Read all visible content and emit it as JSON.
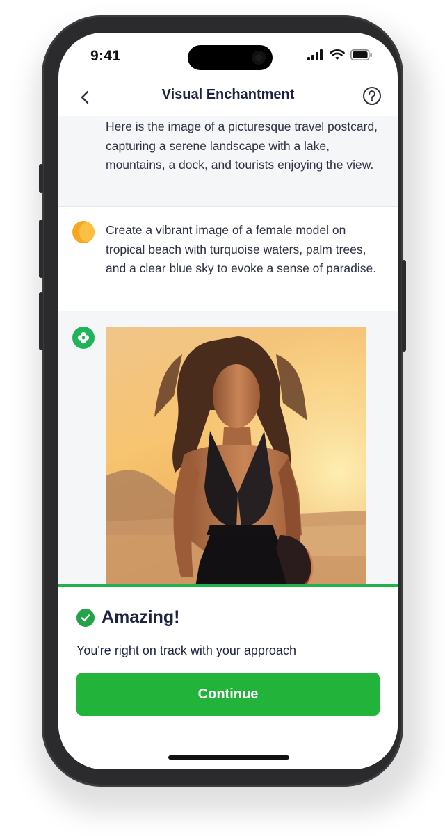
{
  "status_bar": {
    "time": "9:41"
  },
  "header": {
    "title": "Visual Enchantment",
    "back_icon": "chevron-left-icon",
    "help_icon": "question-circle-icon"
  },
  "conversation": {
    "messages": [
      {
        "role": "assistant",
        "text": "Here is the image of a picturesque travel postcard, capturing a serene landscape with a lake, mountains, a dock, and tourists enjoying the view."
      },
      {
        "role": "user",
        "avatar_color": "#f6a623",
        "text": "Create a vibrant image of a female model on tropical beach with turquoise waters, palm trees, and a clear blue sky to evoke a sense of paradise."
      },
      {
        "role": "assistant",
        "avatar_color": "#21b35a",
        "image": "generated-image"
      }
    ]
  },
  "feedback": {
    "icon": "check-circle-icon",
    "title": "Amazing!",
    "subtitle": "You're right on track with your approach",
    "button_label": "Continue",
    "accent_color": "#22b33b"
  }
}
